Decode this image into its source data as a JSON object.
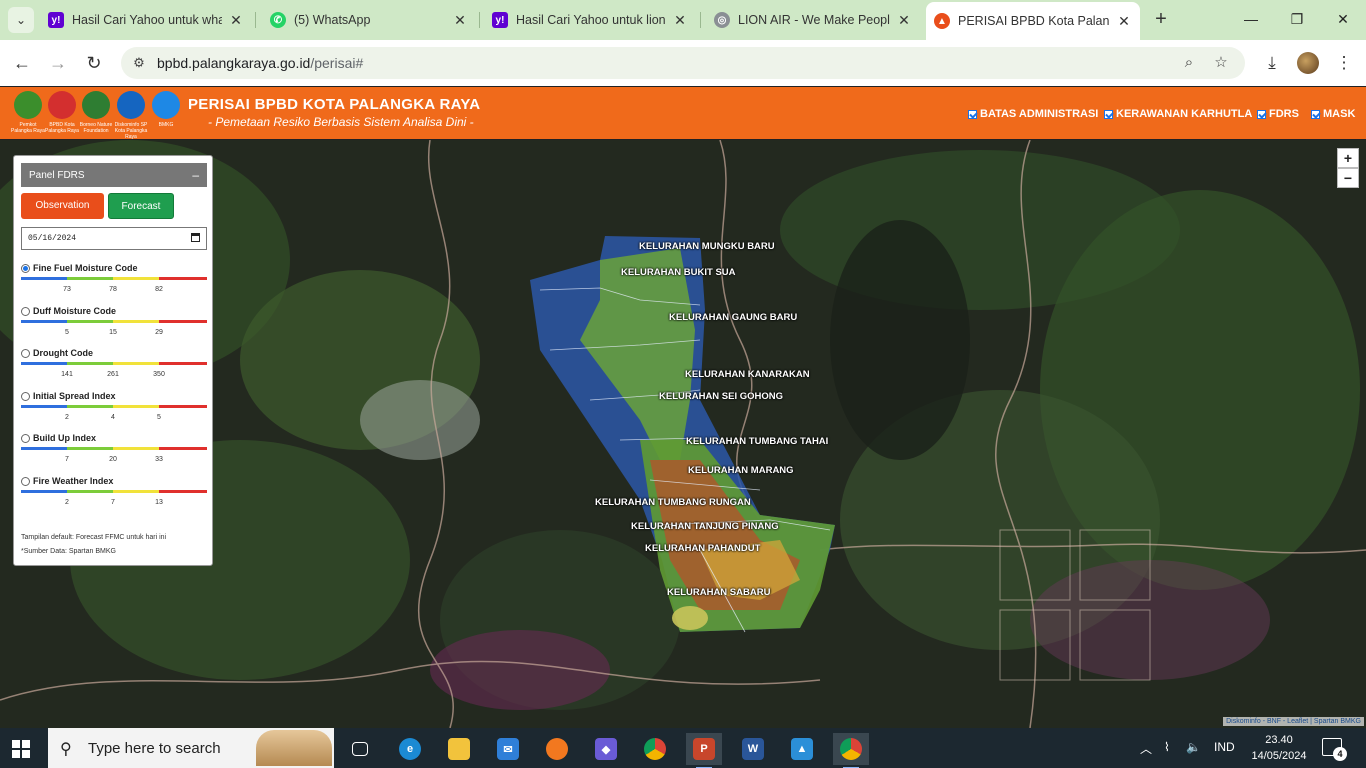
{
  "browser": {
    "tabs": [
      {
        "title": "Hasil Cari Yahoo untuk what",
        "favicon": "yahoo-icon",
        "color": "#6001d2"
      },
      {
        "title": "(5) WhatsApp",
        "favicon": "whatsapp-icon",
        "color": "#25d366"
      },
      {
        "title": "Hasil Cari Yahoo untuk lion a",
        "favicon": "yahoo-icon",
        "color": "#6001d2"
      },
      {
        "title": "LION AIR - We Make People",
        "favicon": "globe-icon",
        "color": "#5f6368"
      },
      {
        "title": "PERISAI BPBD Kota Palangka",
        "favicon": "bpbd-icon",
        "color": "#e94e1b"
      }
    ],
    "url_host": "bpbd.palangkaraya.go.id",
    "url_path": "/perisai#"
  },
  "header": {
    "title": "PERISAI BPBD KOTA PALANGKA RAYA",
    "subtitle": "- Pemetaan Resiko Berbasis Sistem Analisa Dini -",
    "logos": [
      {
        "caption": "Pemkot Palangka Raya",
        "color": "#3b8e2c"
      },
      {
        "caption": "BPBD Kota Palangka Raya",
        "color": "#d32f2f"
      },
      {
        "caption": "Borneo Nature Foundation",
        "color": "#2e7d32"
      },
      {
        "caption": "Diskominfo SP Kota Palangka Raya",
        "color": "#1565c0"
      },
      {
        "caption": "BMKG",
        "color": "#1e88e5"
      }
    ],
    "layers": [
      "BATAS ADMINISTRASI",
      "KERAWANAN KARHUTLA",
      "FDRS",
      "MASK"
    ]
  },
  "panel": {
    "title": "Panel FDRS",
    "minimize": "–",
    "observation_label": "Observation",
    "forecast_label": "Forecast",
    "date_value": "05/16/2024",
    "indices": [
      {
        "name": "Fine Fuel Moisture Code",
        "ticks": [
          "73",
          "78",
          "82"
        ],
        "selected": true
      },
      {
        "name": "Duff Moisture Code",
        "ticks": [
          "5",
          "15",
          "29"
        ],
        "selected": false
      },
      {
        "name": "Drought Code",
        "ticks": [
          "141",
          "261",
          "350"
        ],
        "selected": false
      },
      {
        "name": "Initial Spread Index",
        "ticks": [
          "2",
          "4",
          "5"
        ],
        "selected": false
      },
      {
        "name": "Build Up Index",
        "ticks": [
          "7",
          "20",
          "33"
        ],
        "selected": false
      },
      {
        "name": "Fire Weather Index",
        "ticks": [
          "2",
          "7",
          "13"
        ],
        "selected": false
      }
    ],
    "scale_colors": [
      "#2f6fde",
      "#7ccc3a",
      "#f1e23a",
      "#e0302d"
    ],
    "note_default": "Tampilan default: Forecast FFMC untuk hari ini",
    "note_source": "*Sumber Data: Spartan BMKG"
  },
  "map": {
    "kelurahan": [
      "KELURAHAN MUNGKU BARU",
      "KELURAHAN BUKIT SUA",
      "KELURAHAN GAUNG BARU",
      "KELURAHAN KANARAKAN",
      "KELURAHAN SEI GOHONG",
      "KELURAHAN TUMBANG TAHAI",
      "KELURAHAN MARANG",
      "KELURAHAN TUMBANG RUNGAN",
      "KELURAHAN TANJUNG PINANG",
      "KELURAHAN PAHANDUT",
      "KELURAHAN SABARU"
    ],
    "zoom_in": "+",
    "zoom_out": "−",
    "attribution": "Diskominfo - BNF - Leaflet | Spartan BMKG"
  },
  "taskbar": {
    "search_placeholder": "Type here to search",
    "lang": "IND",
    "time": "23.40",
    "date": "14/05/2024",
    "notifications": "4"
  }
}
